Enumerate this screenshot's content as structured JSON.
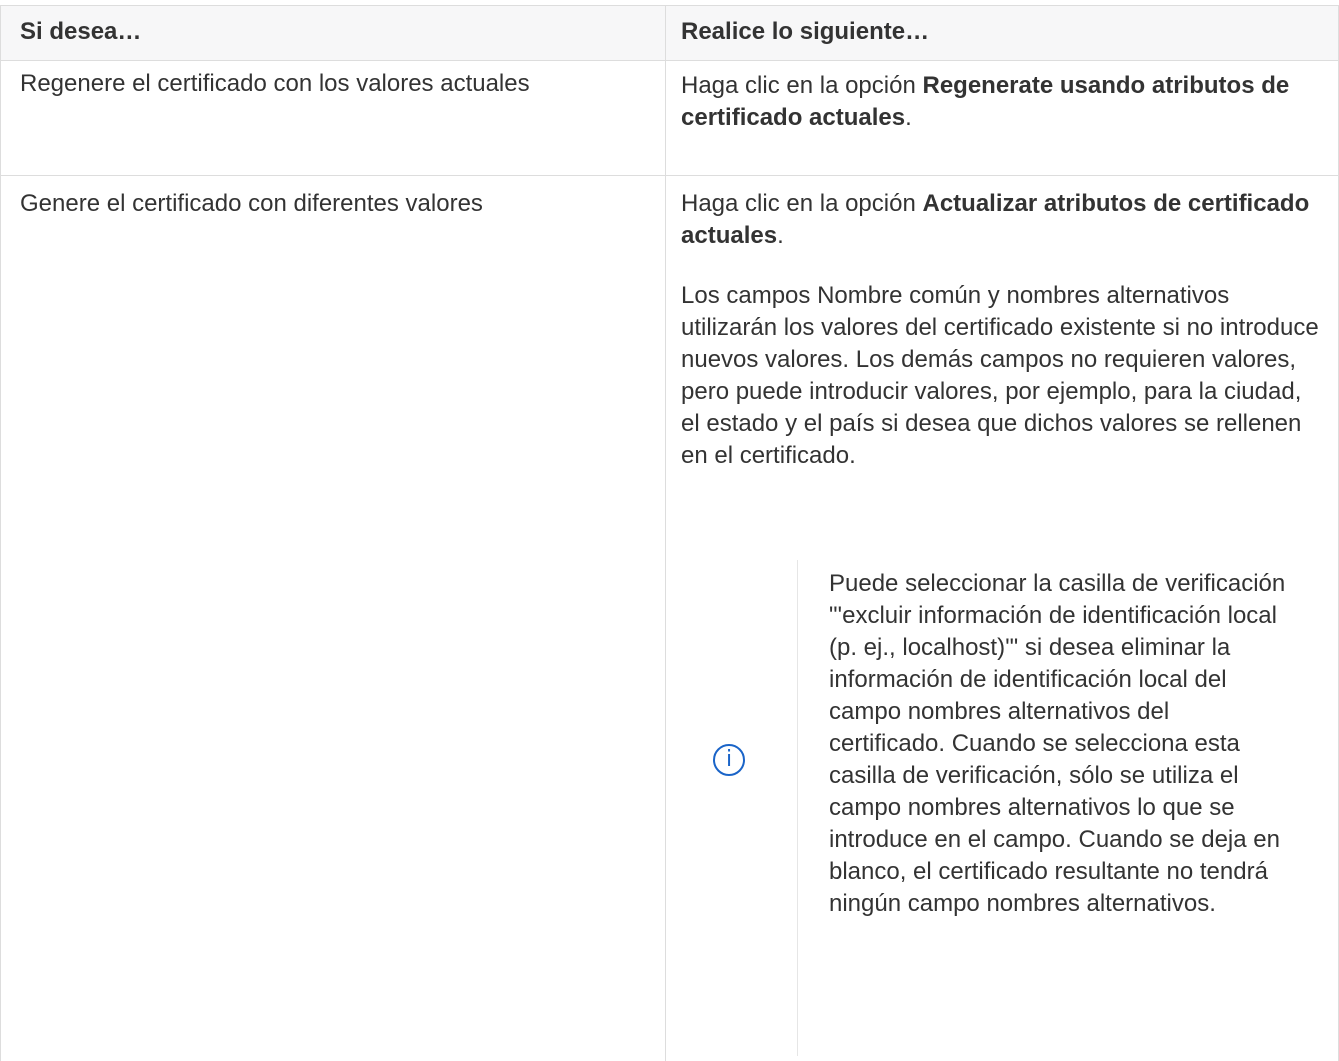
{
  "table": {
    "header": {
      "col1": "Si desea…",
      "col2": "Realice lo siguiente…"
    },
    "rows": [
      {
        "want": "Regenere el certificado con los valores actuales",
        "action_prefix": "Haga clic en la opción ",
        "action_bold": "Regenerate usando atributos de certificado actuales",
        "action_suffix": "."
      },
      {
        "want": "Genere el certificado con diferentes valores",
        "action_prefix": "Haga clic en la opción ",
        "action_bold": "Actualizar atributos de certificado actuales",
        "action_suffix": ".",
        "detail": "Los campos Nombre común y nombres alternativos utilizarán los valores del certificado existente si no introduce nuevos valores. Los demás campos no requieren valores, pero puede introducir valores, por ejemplo, para la ciudad, el estado y el país si desea que dichos valores se rellenen en el certificado.",
        "note": {
          "icon": "info-icon",
          "icon_glyph": "i",
          "text": "Puede seleccionar la casilla de verificación \"'excluir información de identificación local (p. ej., localhost)'\" si desea eliminar la información de identificación local del campo nombres alternativos del certificado. Cuando se selecciona esta casilla de verificación, sólo se utiliza el campo nombres alternativos lo que se introduce en el campo. Cuando se deja en blanco, el certificado resultante no tendrá ningún campo nombres alternativos."
        }
      }
    ]
  },
  "colors": {
    "text": "#333333",
    "header_bg": "#f7f7f8",
    "border": "#dddddd",
    "info_icon": "#1a64c8"
  }
}
